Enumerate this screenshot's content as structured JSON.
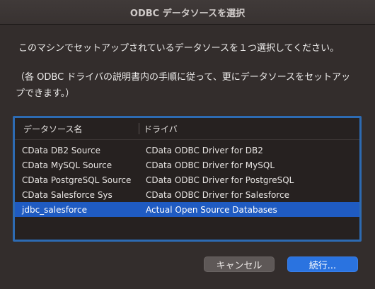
{
  "window": {
    "title": "ODBC データソースを選択"
  },
  "instruction": "このマシンでセットアップされているデータソースを１つ選択してください。",
  "note": "（各 ODBC ドライバの説明書内の手順に従って、更にデータソースをセットアップできます。）",
  "table": {
    "columns": [
      "データソース名",
      "ドライバ"
    ],
    "rows": [
      {
        "name": "CData DB2 Source",
        "driver": "CData ODBC Driver for DB2"
      },
      {
        "name": "CData MySQL Source",
        "driver": "CData ODBC Driver for MySQL"
      },
      {
        "name": "CData PostgreSQL Source",
        "driver": "CData ODBC Driver for PostgreSQL"
      },
      {
        "name": "CData Salesforce Sys",
        "driver": "CData ODBC Driver for Salesforce"
      },
      {
        "name": "jdbc_salesforce",
        "driver": "Actual Open Source Databases"
      }
    ],
    "selected_index": 4
  },
  "buttons": {
    "cancel": "キャンセル",
    "continue": "続行..."
  },
  "colors": {
    "accent": "#2a73e0",
    "selection": "#1f5bc2",
    "focus_ring": "#2d6bb3"
  }
}
